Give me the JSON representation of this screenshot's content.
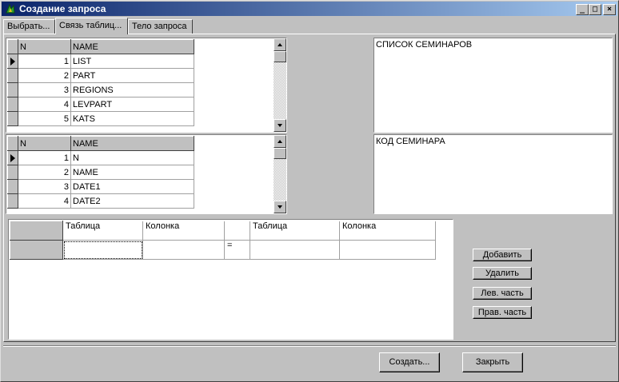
{
  "window": {
    "title": "Создание запроса",
    "minimize": "_",
    "maximize": "□",
    "close": "×"
  },
  "tabs": [
    {
      "label": "Выбрать..."
    },
    {
      "label": "Связь таблиц..."
    },
    {
      "label": "Тело запроса"
    }
  ],
  "grid1": {
    "columns": [
      "N",
      "NAME"
    ],
    "rows": [
      {
        "n": "1",
        "name": "LIST"
      },
      {
        "n": "2",
        "name": "PART"
      },
      {
        "n": "3",
        "name": "REGIONS"
      },
      {
        "n": "4",
        "name": "LEVPART"
      },
      {
        "n": "5",
        "name": "KATS"
      }
    ],
    "memo": "СПИСОК СЕМИНАРОВ"
  },
  "grid2": {
    "columns": [
      "N",
      "NAME"
    ],
    "rows": [
      {
        "n": "1",
        "name": "N"
      },
      {
        "n": "2",
        "name": "NAME"
      },
      {
        "n": "3",
        "name": "DATE1"
      },
      {
        "n": "4",
        "name": "DATE2"
      }
    ],
    "memo": "КОД СЕМИНАРА"
  },
  "join": {
    "headers": [
      "Таблица",
      "Колонка",
      "",
      "Таблица",
      "Колонка"
    ],
    "row": [
      "",
      "",
      "=",
      "",
      ""
    ]
  },
  "side_buttons": {
    "add": "Добавить",
    "delete": "Удалить",
    "left": "Лев. часть",
    "right": "Прав. часть"
  },
  "footer": {
    "create": "Создать...",
    "close": "Закрыть"
  }
}
